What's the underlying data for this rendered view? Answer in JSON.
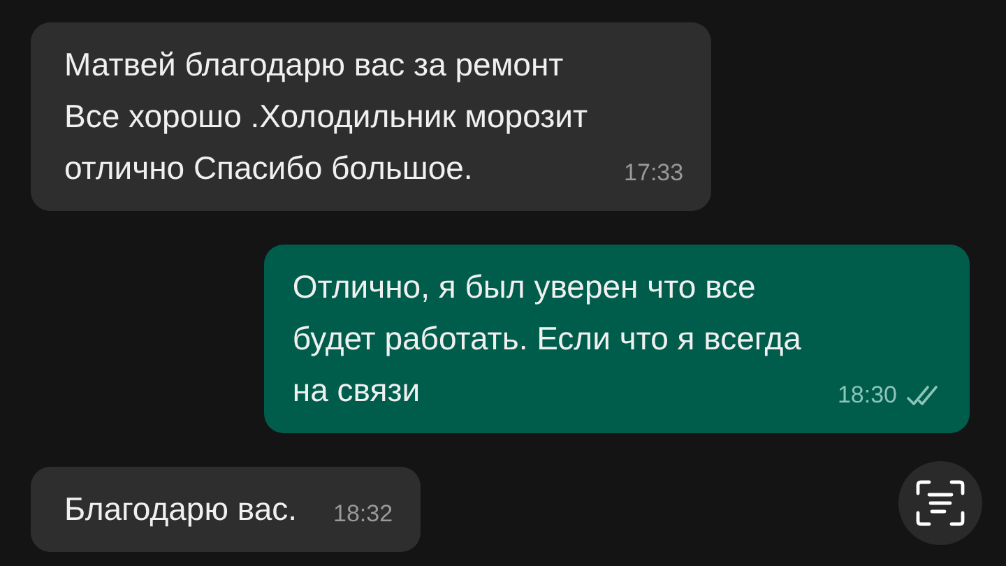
{
  "messages": [
    {
      "kind": "incoming",
      "text": "Матвей благодарю вас за ремонт\nВсе хорошо .Холодильник морозит\nотлично Спасибо большое.",
      "time": "17:33"
    },
    {
      "kind": "outgoing",
      "text": "Отлично, я был уверен что все\nбудет работать. Если что я всегда\nна связи",
      "time": "18:30",
      "read": false
    },
    {
      "kind": "incoming",
      "text": "Благодарю вас.",
      "time": "18:32"
    }
  ]
}
